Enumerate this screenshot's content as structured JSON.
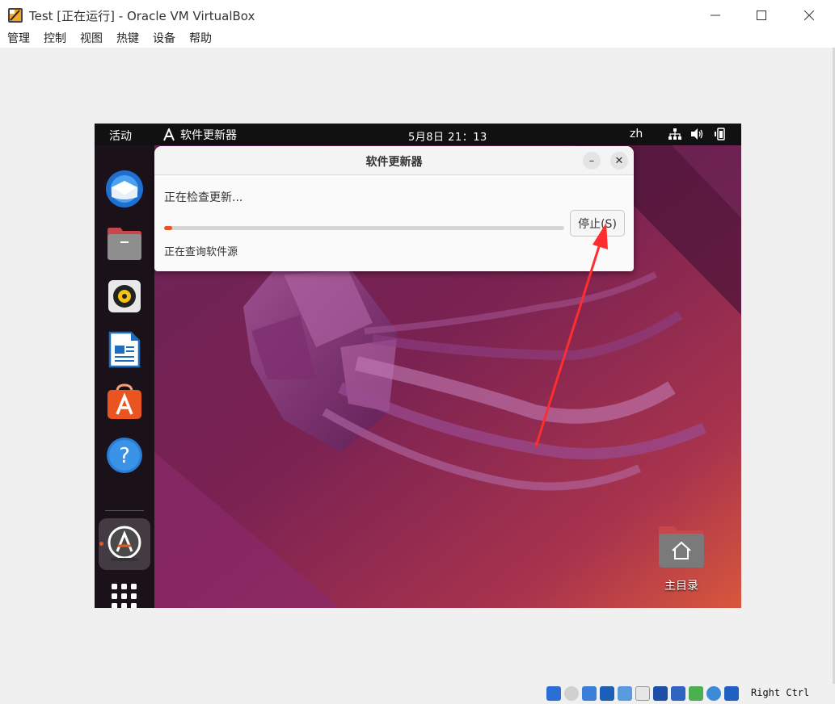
{
  "window": {
    "title": "Test [正在运行] - Oracle VM VirtualBox",
    "controls": {
      "minimize": "—",
      "maximize": "☐",
      "close": "✕"
    }
  },
  "menubar": {
    "items": [
      "管理",
      "控制",
      "视图",
      "热键",
      "设备",
      "帮助"
    ]
  },
  "guest": {
    "topbar": {
      "activities": "活动",
      "app_name": "软件更新器",
      "clock": "5月8日  21：13",
      "lang": "zh"
    },
    "dock": {
      "apps": [
        {
          "name": "thunderbird-icon"
        },
        {
          "name": "files-icon"
        },
        {
          "name": "rhythmbox-icon"
        },
        {
          "name": "writer-icon"
        },
        {
          "name": "software-icon"
        },
        {
          "name": "help-icon"
        },
        {
          "name": "software-updater-icon"
        },
        {
          "name": "show-apps-icon"
        }
      ]
    },
    "dialog": {
      "title": "软件更新器",
      "minimize": "–",
      "close": "✕",
      "status": "正在检查更新...",
      "progress": 0.02,
      "stop_button": "停止(S)",
      "sub_status": "正在查询软件源"
    },
    "desktop": {
      "home_label": "主目录"
    }
  },
  "statusbar": {
    "host_key": "Right Ctrl"
  },
  "colors": {
    "accent": "#e95420",
    "arrow": "#ff2d2d"
  }
}
